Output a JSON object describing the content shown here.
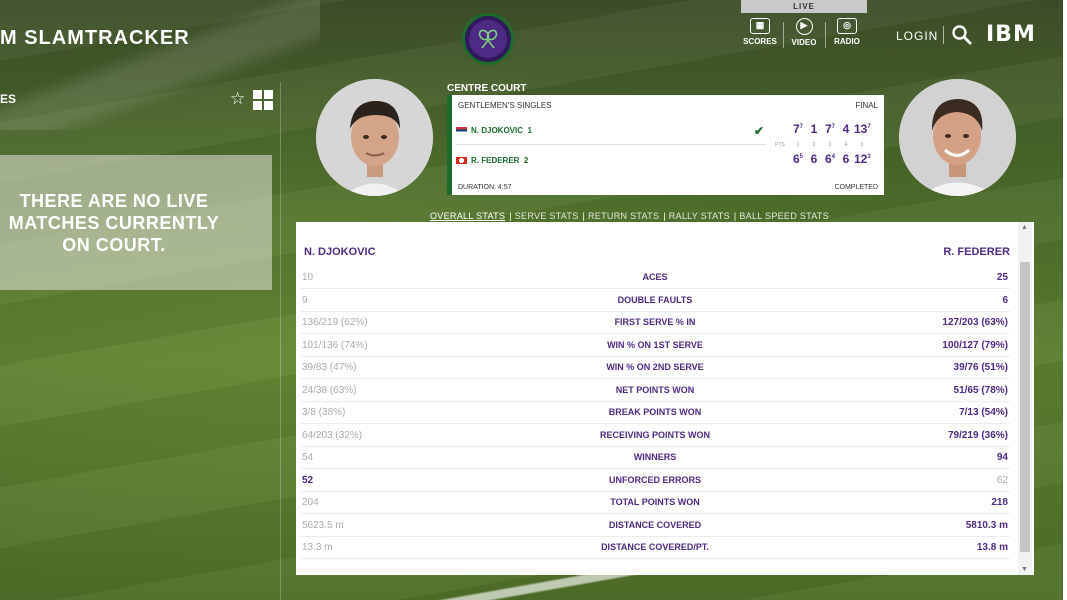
{
  "header": {
    "brand": "M SLAMTRACKER",
    "live_label": "LIVE",
    "nav": [
      {
        "label": "SCORES",
        "icon": "scoreboard-icon"
      },
      {
        "label": "VIDEO",
        "icon": "play-icon"
      },
      {
        "label": "RADIO",
        "icon": "radio-icon"
      }
    ],
    "login": "LOGIN",
    "ibm": "IBM"
  },
  "sidebar": {
    "title": "ES",
    "no_live_text": "THERE ARE NO LIVE MATCHES CURRENTLY ON COURT."
  },
  "match": {
    "court": "CENTRE COURT",
    "event": "GENTLEMEN'S SINGLES",
    "status": "FINAL",
    "duration": "DURATION: 4:57",
    "completed": "COMPLETED",
    "pts_label": "PTS",
    "set_numbers": [
      "1",
      "2",
      "3",
      "4",
      "5"
    ],
    "player1": {
      "name": "N. DJOKOVIC",
      "seed": "1",
      "sets": [
        {
          "g": "7",
          "tb": "7"
        },
        {
          "g": "1",
          "tb": ""
        },
        {
          "g": "7",
          "tb": "7"
        },
        {
          "g": "4",
          "tb": ""
        },
        {
          "g": "13",
          "tb": "7"
        }
      ]
    },
    "player2": {
      "name": "R. FEDERER",
      "seed": "2",
      "sets": [
        {
          "g": "6",
          "tb": "5"
        },
        {
          "g": "6",
          "tb": ""
        },
        {
          "g": "6",
          "tb": "4"
        },
        {
          "g": "6",
          "tb": ""
        },
        {
          "g": "12",
          "tb": "3"
        }
      ]
    }
  },
  "stats": {
    "tabs": [
      "OVERALL STATS",
      "SERVE STATS",
      "RETURN STATS",
      "RALLY STATS",
      "BALL SPEED STATS"
    ],
    "player1": "N. DJOKOVIC",
    "player2": "R. FEDERER",
    "rows": [
      {
        "label": "ACES",
        "p1": "10",
        "p2": "25",
        "winner": "p2"
      },
      {
        "label": "DOUBLE FAULTS",
        "p1": "9",
        "p2": "6",
        "winner": "p2"
      },
      {
        "label": "FIRST SERVE % IN",
        "p1": "136/219 (62%)",
        "p2": "127/203 (63%)",
        "winner": "p2"
      },
      {
        "label": "WIN % ON 1ST SERVE",
        "p1": "101/136 (74%)",
        "p2": "100/127 (79%)",
        "winner": "p2"
      },
      {
        "label": "WIN % ON 2ND SERVE",
        "p1": "39/83 (47%)",
        "p2": "39/76 (51%)",
        "winner": "p2"
      },
      {
        "label": "NET POINTS WON",
        "p1": "24/38 (63%)",
        "p2": "51/65 (78%)",
        "winner": "p2"
      },
      {
        "label": "BREAK POINTS WON",
        "p1": "3/8 (38%)",
        "p2": "7/13 (54%)",
        "winner": "p2"
      },
      {
        "label": "RECEIVING POINTS WON",
        "p1": "64/203 (32%)",
        "p2": "79/219 (36%)",
        "winner": "p2"
      },
      {
        "label": "WINNERS",
        "p1": "54",
        "p2": "94",
        "winner": "p2"
      },
      {
        "label": "UNFORCED ERRORS",
        "p1": "52",
        "p2": "62",
        "winner": "p1"
      },
      {
        "label": "TOTAL POINTS WON",
        "p1": "204",
        "p2": "218",
        "winner": "p2"
      },
      {
        "label": "DISTANCE COVERED",
        "p1": "5623.5 m",
        "p2": "5810.3 m",
        "winner": "p2"
      },
      {
        "label": "DISTANCE COVERED/PT.",
        "p1": "13.3 m",
        "p2": "13.8 m",
        "winner": "p2"
      }
    ]
  },
  "colors": {
    "purple": "#4e2a84",
    "green": "#1d6b2d"
  }
}
